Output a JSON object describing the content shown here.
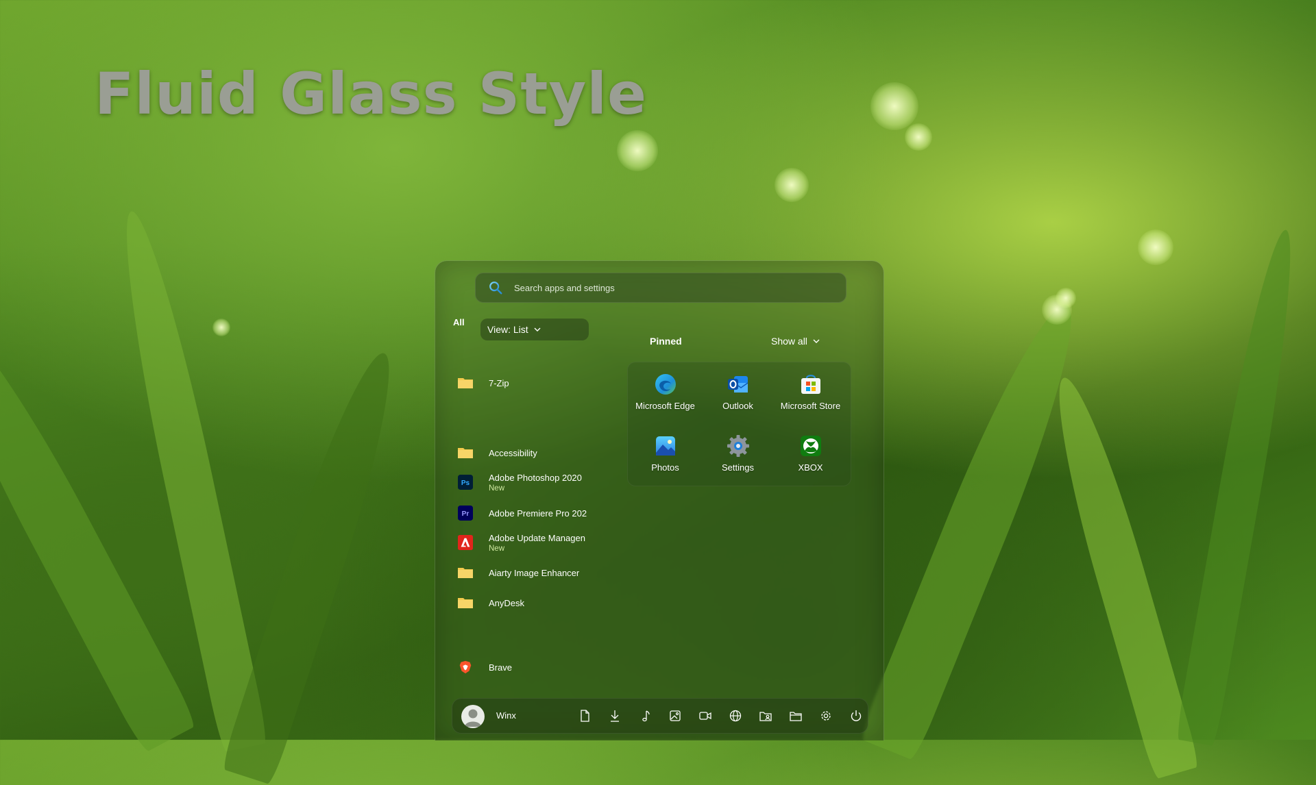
{
  "hero": {
    "title": "Fluid Glass Style"
  },
  "search": {
    "placeholder": "Search apps and settings"
  },
  "all_apps": {
    "label": "All",
    "view_dropdown": "View: List",
    "items": [
      {
        "name": "7-Zip",
        "badge": "",
        "icon": "folder-icon"
      },
      {
        "name": "Accessibility",
        "badge": "",
        "icon": "folder-icon"
      },
      {
        "name": "Adobe Photoshop 2020",
        "badge": "New",
        "icon": "photoshop-icon"
      },
      {
        "name": "Adobe Premiere Pro 202",
        "badge": "",
        "icon": "premiere-icon"
      },
      {
        "name": "Adobe Update Managen",
        "badge": "New",
        "icon": "adobe-icon"
      },
      {
        "name": "Aiarty Image Enhancer",
        "badge": "",
        "icon": "folder-icon"
      },
      {
        "name": "AnyDesk",
        "badge": "",
        "icon": "folder-icon"
      },
      {
        "name": "Brave",
        "badge": "",
        "icon": "brave-icon"
      }
    ]
  },
  "pinned": {
    "label": "Pinned",
    "show_all": "Show all",
    "apps": [
      {
        "name": "Microsoft Edge",
        "icon": "edge-icon"
      },
      {
        "name": "Outlook",
        "icon": "outlook-icon"
      },
      {
        "name": "Microsoft Store",
        "icon": "store-icon"
      },
      {
        "name": "Photos",
        "icon": "photos-icon"
      },
      {
        "name": "Settings",
        "icon": "settings-icon"
      },
      {
        "name": "XBOX",
        "icon": "xbox-icon"
      }
    ]
  },
  "bottom_bar": {
    "user_name": "Winx",
    "buttons": [
      "documents-icon",
      "downloads-icon",
      "music-icon",
      "pictures-icon",
      "videos-icon",
      "network-icon",
      "personal-folder-icon",
      "file-explorer-icon",
      "settings-icon",
      "power-icon"
    ]
  },
  "colors": {
    "accent_green": "#cfe8a0",
    "folder_yellow": "#f3c94c",
    "photoshop_blue": "#001e36",
    "premiere_purple": "#00005b",
    "adobe_red": "#e1251b"
  }
}
